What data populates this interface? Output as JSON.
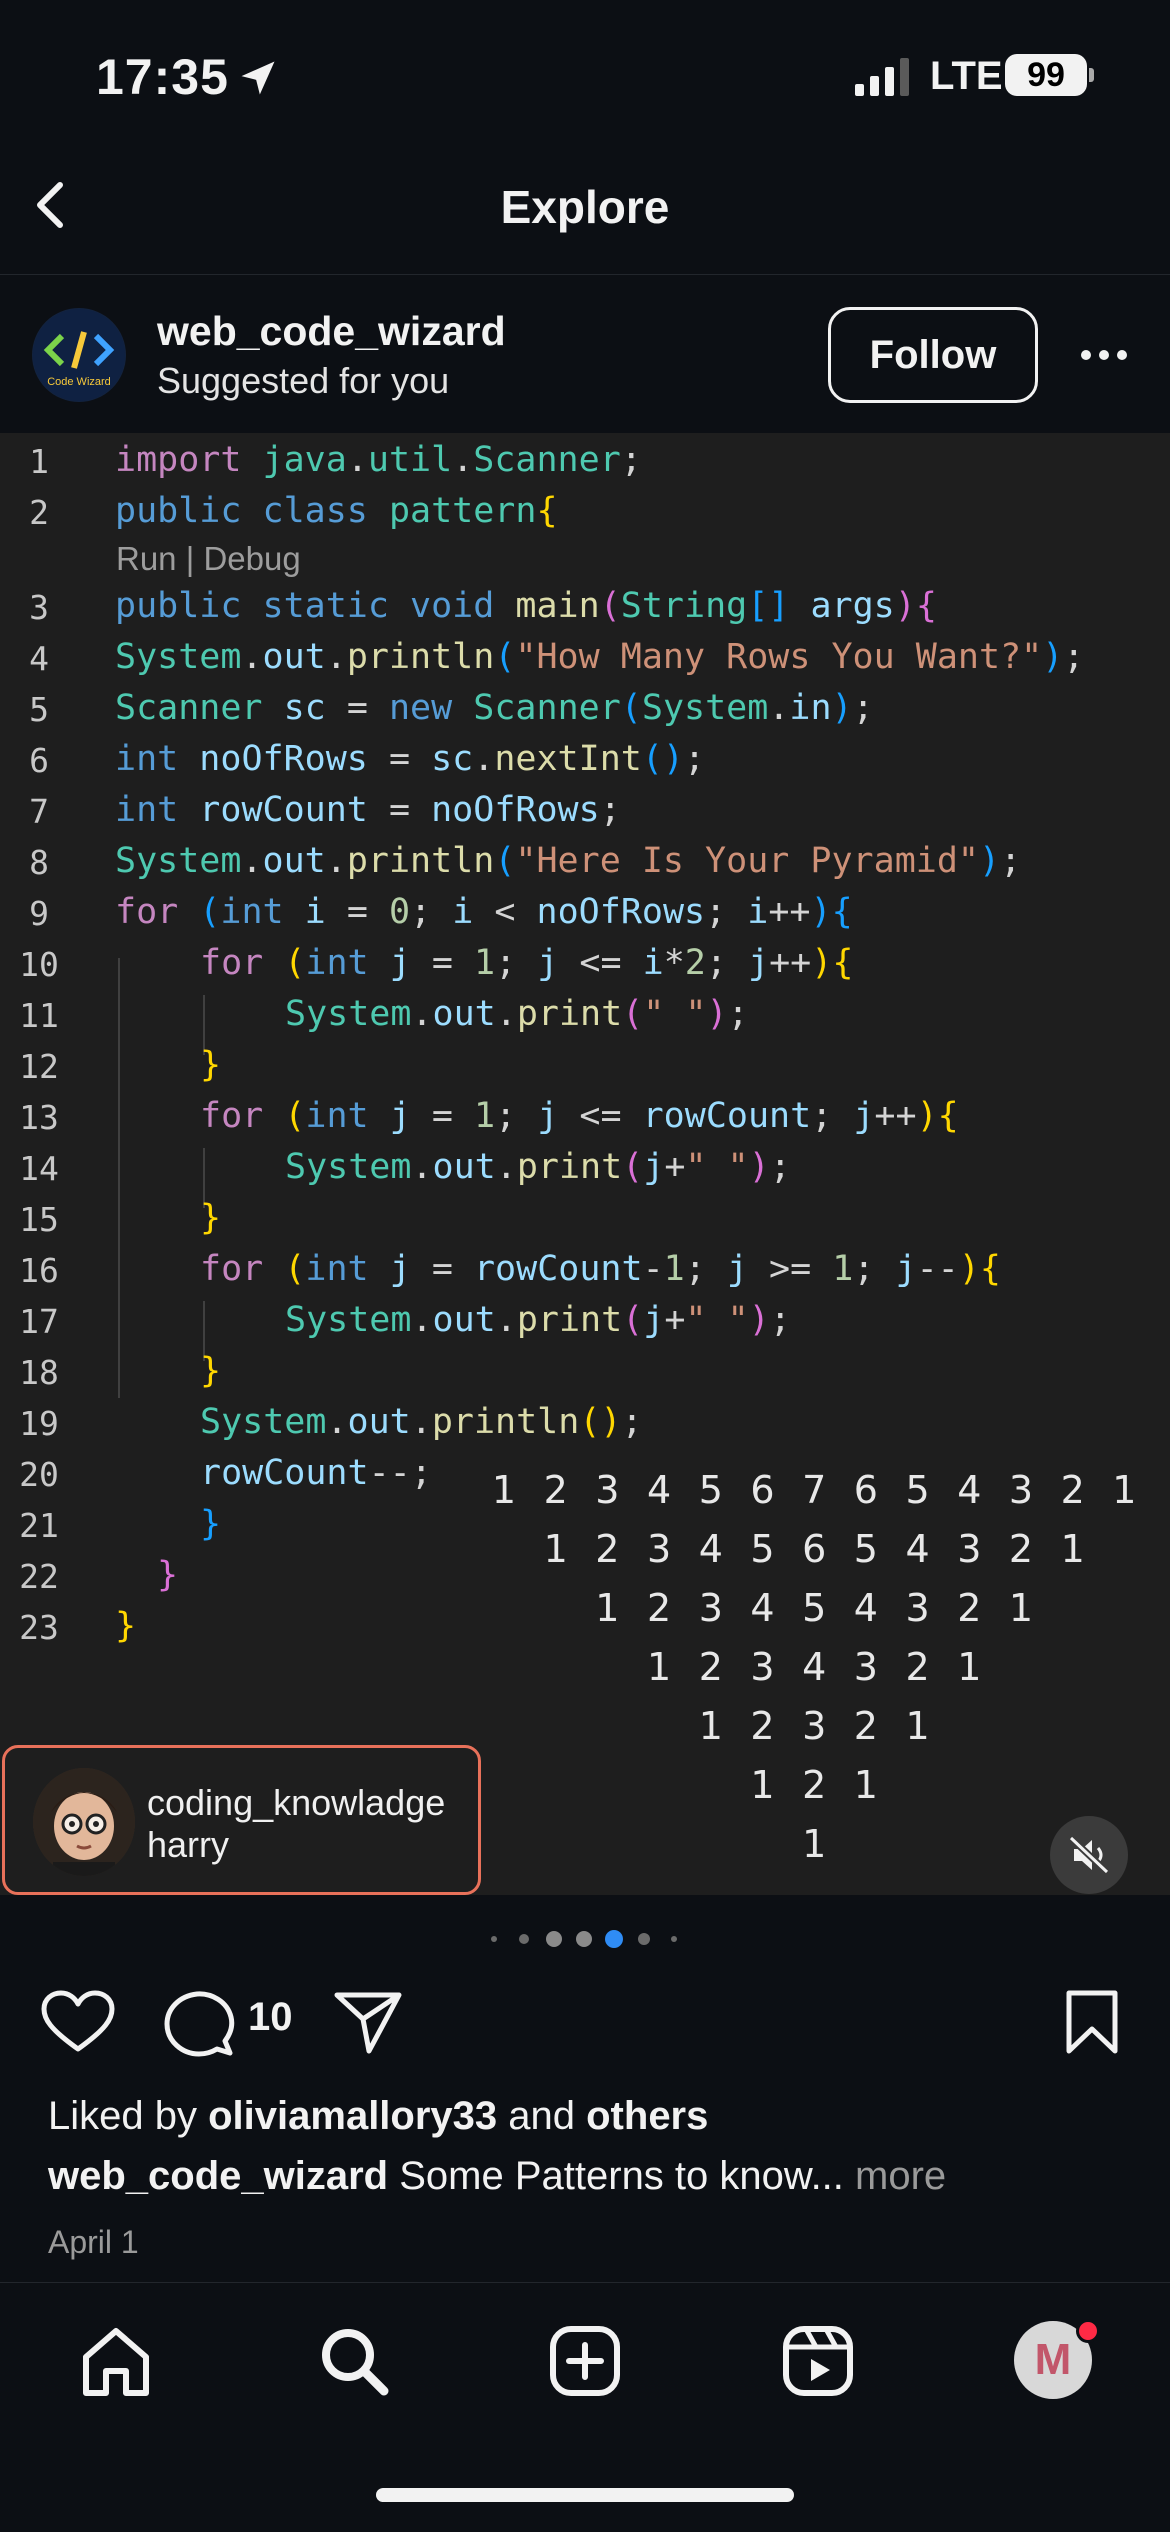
{
  "status_bar": {
    "time": "17:35",
    "network": "LTE",
    "battery": "99"
  },
  "header": {
    "title": "Explore"
  },
  "post": {
    "username": "web_code_wizard",
    "subtitle": "Suggested for you",
    "avatar_text": "Code Wizard",
    "follow_label": "Follow",
    "code": {
      "codelens": "Run | Debug",
      "line_numbers": [
        "1",
        "2",
        "3",
        "4",
        "5",
        "6",
        "7",
        "8",
        "9",
        "10",
        "11",
        "12",
        "13",
        "14",
        "15",
        "16",
        "17",
        "18",
        "19",
        "20",
        "21",
        "22",
        "23"
      ]
    },
    "pyramid_rows": [
      [
        "1",
        "2",
        "3",
        "4",
        "5",
        "6",
        "7",
        "6",
        "5",
        "4",
        "3",
        "2",
        "1"
      ],
      [
        "1",
        "2",
        "3",
        "4",
        "5",
        "6",
        "5",
        "4",
        "3",
        "2",
        "1"
      ],
      [
        "1",
        "2",
        "3",
        "4",
        "5",
        "4",
        "3",
        "2",
        "1"
      ],
      [
        "1",
        "2",
        "3",
        "4",
        "3",
        "2",
        "1"
      ],
      [
        "1",
        "2",
        "3",
        "2",
        "1"
      ],
      [
        "1",
        "2",
        "1"
      ],
      [
        "1"
      ]
    ],
    "tagged_user": {
      "line1": "coding_knowladge",
      "line2": "harry"
    },
    "carousel": {
      "count": 7,
      "active_index": 4
    },
    "comment_count": "10",
    "liked_by_prefix": "Liked by ",
    "liked_by_user": "oliviamallory33",
    "liked_by_and": " and ",
    "liked_by_others": "others",
    "caption_user": "web_code_wizard",
    "caption_text": " Some Patterns to know... ",
    "caption_more": "more",
    "date": "April 1"
  },
  "tab_bar": {
    "items": [
      "home-icon",
      "search-icon",
      "create-icon",
      "reels-icon",
      "profile-avatar"
    ],
    "profile_letter": "M"
  },
  "colors": {
    "background": "#0c0f14",
    "code_bg": "#1e1e1e",
    "tag_border": "#e8715a",
    "active_dot": "#2f8cf5",
    "notification": "#ff2a45"
  }
}
